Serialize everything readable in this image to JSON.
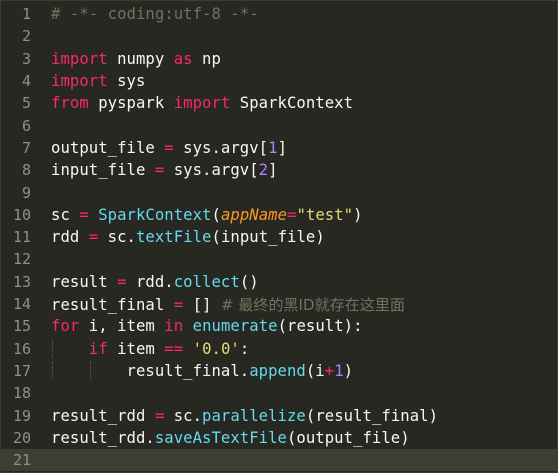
{
  "editor": {
    "active_line": 21,
    "line_numbers": [
      "1",
      "2",
      "3",
      "4",
      "5",
      "6",
      "7",
      "8",
      "9",
      "10",
      "11",
      "12",
      "13",
      "14",
      "15",
      "16",
      "17",
      "18",
      "19",
      "20",
      "21"
    ],
    "tokens": {
      "l1": {
        "comment": "# -*- coding:utf-8 -*-"
      },
      "l3": {
        "kw_import": "import",
        "mod": " numpy ",
        "kw_as": "as",
        "alias": " np"
      },
      "l4": {
        "kw_import": "import",
        "mod": " sys"
      },
      "l5": {
        "kw_from": "from",
        "mod": " pyspark ",
        "kw_import": "import",
        "name": " SparkContext"
      },
      "l7": {
        "lhs": "output_file ",
        "op": "=",
        "mid": " sys.argv[",
        "num": "1",
        "end": "]"
      },
      "l8": {
        "lhs": "input_file ",
        "op": "=",
        "mid": " sys.argv[",
        "num": "2",
        "end": "]"
      },
      "l10": {
        "lhs": "sc ",
        "op": "=",
        "sp": " ",
        "fn": "SparkContext",
        "open": "(",
        "param": "appName",
        "eq": "=",
        "str": "\"test\"",
        "close": ")"
      },
      "l11": {
        "lhs": "rdd ",
        "op": "=",
        "mid": " sc.",
        "fn": "textFile",
        "args": "(input_file)"
      },
      "l13": {
        "lhs": "result ",
        "op": "=",
        "mid": " rdd.",
        "fn": "collect",
        "args": "()"
      },
      "l14": {
        "lhs": "result_final ",
        "op": "=",
        "mid": " [] ",
        "comment": "# 最终的黑ID就存在这里面"
      },
      "l15": {
        "kw_for": "for",
        "mid": " i, item ",
        "kw_in": "in",
        "sp": " ",
        "fn": "enumerate",
        "args": "(result):"
      },
      "l16": {
        "indent": "    ",
        "kw_if": "if",
        "mid": " item ",
        "op": "==",
        "sp": " ",
        "str": "'0.0'",
        "end": ":"
      },
      "l17": {
        "indent": "        ",
        "mid": "result_final.",
        "fn": "append",
        "open": "(i",
        "op": "+",
        "num": "1",
        "close": ")"
      },
      "l19": {
        "lhs": "result_rdd ",
        "op": "=",
        "mid": " sc.",
        "fn": "parallelize",
        "args": "(result_final)"
      },
      "l20": {
        "mid": "result_rdd.",
        "fn": "saveAsTextFile",
        "args": "(output_file)"
      }
    }
  }
}
